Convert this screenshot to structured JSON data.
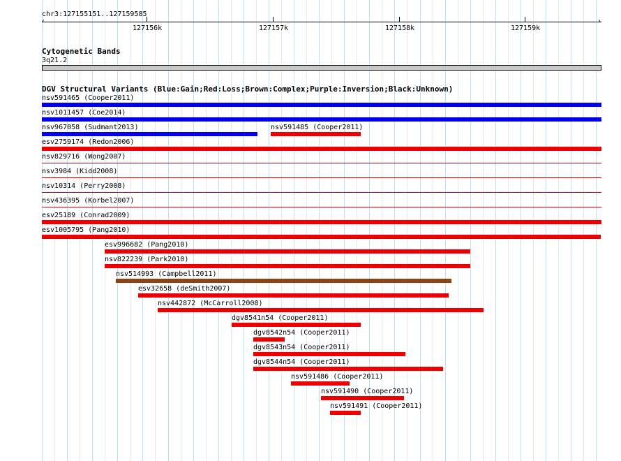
{
  "ruler": {
    "range": "chr3:127155151..127159585",
    "ticks": [
      "127156k",
      "127157k",
      "127158k",
      "127159k"
    ]
  },
  "cytoband": {
    "title": "Cytogenetic Bands",
    "band": "3q21.2"
  },
  "dgv": {
    "title": "DGV Structural Variants (Blue:Gain;Red:Loss;Brown:Complex;Purple:Inversion;Black:Unknown)",
    "colors": {
      "gain": "#0000ee",
      "loss": "#ee0000",
      "complex": "#8b4513",
      "thin_loss": "#cc0000"
    },
    "variants": [
      {
        "label": "nsv591465 (Cooper2011)",
        "type": "gain"
      },
      {
        "label": "nsv1011457 (Coe2014)",
        "type": "gain"
      },
      {
        "label": "nsv967058 (Sudmant2013)",
        "type": "gain"
      },
      {
        "label": "nsv591485 (Cooper2011)",
        "type": "loss"
      },
      {
        "label": "esv2759174 (Redon2006)",
        "type": "loss"
      },
      {
        "label": "nsv829716 (Wong2007)",
        "type": "loss"
      },
      {
        "label": "nsv3984 (Kidd2008)",
        "type": "loss"
      },
      {
        "label": "nsv10314 (Perry2008)",
        "type": "loss"
      },
      {
        "label": "nsv436395 (Korbel2007)",
        "type": "loss"
      },
      {
        "label": "esv25189 (Conrad2009)",
        "type": "loss"
      },
      {
        "label": "esv1005795 (Pang2010)",
        "type": "loss"
      },
      {
        "label": "esv996682 (Pang2010)",
        "type": "loss"
      },
      {
        "label": "nsv822239 (Park2010)",
        "type": "loss"
      },
      {
        "label": "nsv514993 (Campbell2011)",
        "type": "complex"
      },
      {
        "label": "esv32658 (deSmith2007)",
        "type": "loss"
      },
      {
        "label": "nsv442872 (McCarroll2008)",
        "type": "loss"
      },
      {
        "label": "dgv8541n54 (Cooper2011)",
        "type": "loss"
      },
      {
        "label": "dgv8542n54 (Cooper2011)",
        "type": "loss"
      },
      {
        "label": "dgv8543n54 (Cooper2011)",
        "type": "loss"
      },
      {
        "label": "dgv8544n54 (Cooper2011)",
        "type": "loss"
      },
      {
        "label": "nsv591486 (Cooper2011)",
        "type": "loss"
      },
      {
        "label": "nsv591490 (Cooper2011)",
        "type": "loss"
      },
      {
        "label": "nsv591491 (Cooper2011)",
        "type": "loss"
      }
    ]
  }
}
